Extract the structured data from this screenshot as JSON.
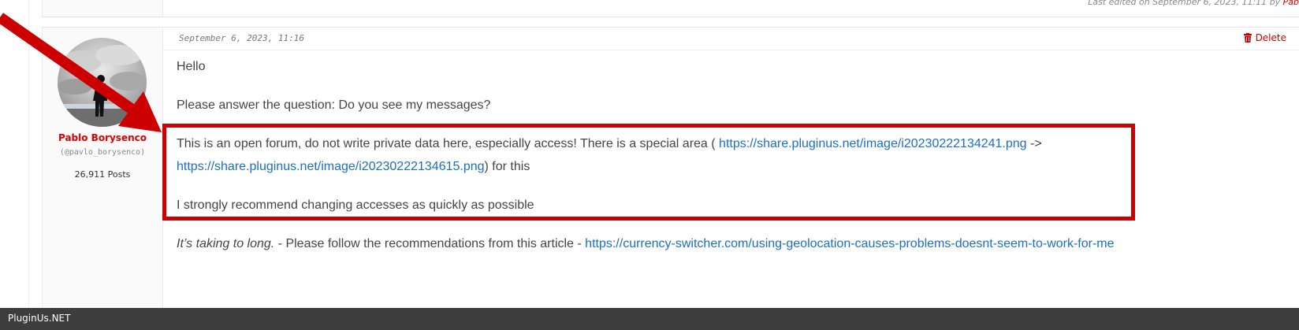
{
  "previous_post": {
    "last_edited_text": "Last edited on September 6, 2023, 11:11 by ",
    "last_edited_by": "Pab"
  },
  "post": {
    "date": "September 6, 2023, 11:16",
    "delete_label": "Delete",
    "author": {
      "name": "Pablo Borysenco",
      "handle": "(@pavlo_borysenco)",
      "posts": "26,911 Posts"
    },
    "body": {
      "greeting": "Hello",
      "question": "Please answer the question:  Do you see my messages?",
      "private_data_text": "This is an open forum, do not write private data here, especially access! There is a special area ( ",
      "link1": "https://share.pluginus.net/image/i20230222134241.png",
      "arrow_text": " ->",
      "link2": "https://share.pluginus.net/image/i20230222134615.png",
      "for_this_text": ") for this",
      "recommend_text": "I strongly recommend changing accesses as quickly as possible",
      "quote_text": "It’s taking to long.",
      "follow_text": " - Please follow the recommendations from this article  - ",
      "link3": "https://currency-switcher.com/using-geolocation-causes-problems-doesnt-seem-to-work-for-me"
    }
  },
  "annotation": {
    "color": "#cc0000"
  },
  "footer": {
    "brand": "PluginUs.NET"
  },
  "colors": {
    "link": "#1a6fc4",
    "author_name": "#dd0000",
    "delete": "#cc0000",
    "footer_bg": "#3d3d3d"
  }
}
